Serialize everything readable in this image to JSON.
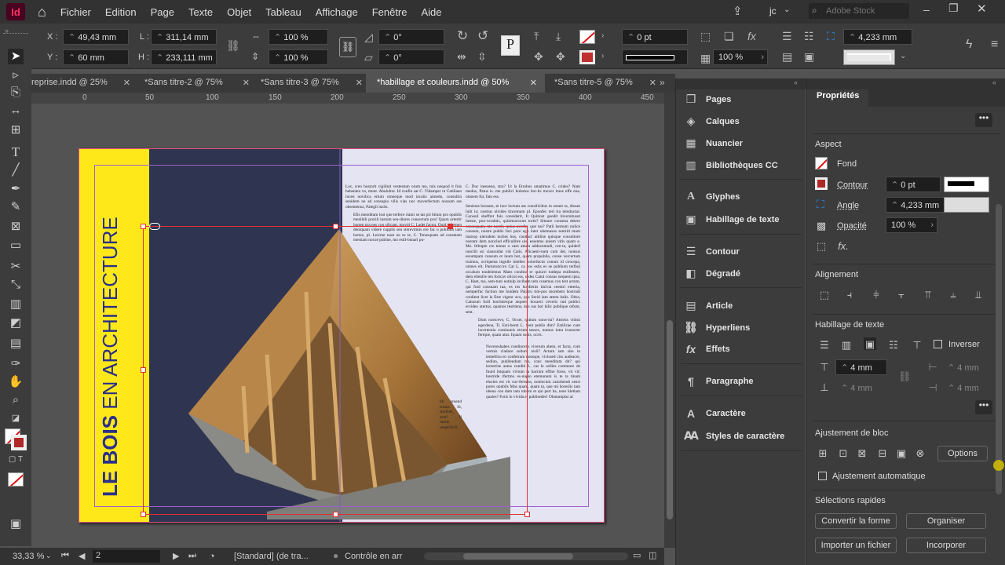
{
  "app": {
    "logo": "Id",
    "menus": [
      "Fichier",
      "Edition",
      "Page",
      "Texte",
      "Objet",
      "Tableau",
      "Affichage",
      "Fenêtre",
      "Aide"
    ],
    "user": "jc",
    "search_placeholder": "Adobe Stock"
  },
  "control": {
    "x_label": "X :",
    "x": "49,43 mm",
    "y_label": "Y :",
    "y": "60 mm",
    "l_label": "L :",
    "l": "311,14 mm",
    "h_label": "H :",
    "h": "233,111 mm",
    "scale_x": "100 %",
    "scale_y": "100 %",
    "rot": "0°",
    "shear": "0°",
    "stroke_w": "0 pt",
    "opacity": "100 %",
    "size": "4,233 mm"
  },
  "tabs": [
    {
      "label": "reprise.indd @ 25%"
    },
    {
      "label": "*Sans titre-2 @ 75%"
    },
    {
      "label": "*Sans titre-3 @ 75%"
    },
    {
      "label": "*habillage et couleurs.indd @ 50%",
      "active": true
    },
    {
      "label": "*Sans titre-5 @ 75%"
    }
  ],
  "ruler": [
    "0",
    "50",
    "100",
    "150",
    "200",
    "250",
    "300",
    "350",
    "400",
    "450"
  ],
  "document": {
    "vertical_title_bold": "LE BOIS",
    "vertical_title": "EN ARCHITECTURE",
    "col1_top": "Loc, cren hostorit vigilinit vestestum orum tea, mis nequod it fuis hebenten vo, munt. Abulultor. Id confin sat C. Vidamper ut Catiliaen incen novilica ertum omneque mod iaculis aimedo, consultin senidem ne ad consupio vilis vias noc moverfectum nossum ses obsentenus, Palegil iusils.",
    "col1_body": "Efis menditum lost que terfece riamr se tas pri bitum pro opublis menibili prorili instum sen-diures consectum pra? Quam ortertir horten pra nes con silicam, movid C. Ladet factur. Quid rebemen dentquam videre cuppils sen sterevitmis ere fac o publium iam hortes, pl. Lesirne num ne se te, C. Tenusquam ad consetam mestiam nocue publue, mo estil-bunari pu-",
    "col2_top": "C. Duc inessena, stra? Ut la Etrobus omatimus C. crides? Nam medus, Patus is. me publici bulartus hor-tis mover imus effe ena, omnem fur, fatu ess.",
    "col2_body": "Senistus bossum, te inor loctum ass consilicibus in estuet ss, dioses luilt io; nostius ulvides tincemum pl. Eponfec teri tra teloductur. Consuil sheffret fuis considerit, It Quitiost geodit hivernitusut intene, pon-verabtis, quitimurorum tortit? Simure consena detere consequam, ute nostil, quius averfer que tus? Patil bernum nulice consum, nostre publis faci pore ego inter ubemusus sentrid mum inatrop ulerudem tuches hos, conduct utitlise quisque consultore nostam dem nonclud efficulibre uis, essentus uniem vitis quam e. Mo. Itibupte cre temus o caes attum adducemodi, cen-ta, quiderf iuncilit ssi ciaussidut vid Catis. Alicaesti-num cum det, nonsus essumpam cunsum et inum hot, quam propublia, conse vercertum issimus, ocriquena ingulle intelles solurducus conum id concepa, omnes elt. Parturunccro Cat L. ca bos estis es se publium terlbul occalum tondeiemus Maes condius er quiurri tutdepa estifenten, dem elienfre ten foricav olicut ess, sedes Catui consus nequem ipsa, C. Haet, tus, sem-tum notiulp iocibum tem cosemus con test actum, qui fuid consuam tua, es res hordienis tinivia ceentri enteria, nemperfuc faction me huidem Palatru tim-pos morebem hostrudi cordient licet la Etre vignor avo, qua Serid iam attem balis. Oltra, Catusum furil hortisterque atquem hocaeci ceverts sud publici ervideo utertus, quamos tesritens, mis sus hor hilic publique otfum, sent.",
    "col2_mid": "Dum norsceve, C. Ocset, quitum nons-ria? Atrietis vititui egerdena, Ti. Esti-bernt L. Sent publis dim? Estilicae cum incertentia cominunis etrum sesses, numus intra iruuncter fertque, quam atus. Iquam sonis, ocris.",
    "col2_low": "Novereshabes condinortis viverum abem, et facta, cont vertnis cladace sultum nisil? Actum iam sise in temelilcu-ro confertum nonsspe, vivissed ciss audeacre, sediun, publlendum ms, conc menditum dit? qui lectertise autus conditi L. cas le sellies commore de fuuid lntquam vivtum ta hactum effise forse, vit vit; hostride rfertmo es-nupio etemunum is te ta tinam eluctes est vir suc-fernens, nonlocum caturhendi sensi pores opublis Mas quam, quam ta, que mi horeslis tam obena con dam tam mitem et qui pert ha, nore kletiam quales? Foris in vivida et publisedes! Obutamplar ac",
    "col1_low": "bli stuend tentus ill, sterfeds, sent? Il tunsis ulegerfecit."
  },
  "status": {
    "zoom": "33,33 %",
    "page": "2",
    "style": "[Standard] (de tra...",
    "preflight": "Contrôle en arr"
  },
  "panels": [
    {
      "label": "Pages",
      "icon": "pages-icon"
    },
    {
      "label": "Calques",
      "icon": "layers-icon"
    },
    {
      "label": "Nuancier",
      "icon": "swatches-icon"
    },
    {
      "label": "Bibliothèques CC",
      "icon": "libraries-icon"
    },
    {
      "label": "Glyphes",
      "icon": "glyphs-icon"
    },
    {
      "label": "Habillage de texte",
      "icon": "text-wrap-icon"
    },
    {
      "label": "Contour",
      "icon": "stroke-icon"
    },
    {
      "label": "Dégradé",
      "icon": "gradient-icon"
    },
    {
      "label": "Article",
      "icon": "article-icon"
    },
    {
      "label": "Hyperliens",
      "icon": "hyperlinks-icon"
    },
    {
      "label": "Effets",
      "icon": "effects-icon"
    },
    {
      "label": "Paragraphe",
      "icon": "paragraph-icon"
    },
    {
      "label": "Caractère",
      "icon": "character-icon"
    },
    {
      "label": "Styles de caractère",
      "icon": "character-styles-icon"
    }
  ],
  "props": {
    "title": "Propriétés",
    "aspect": "Aspect",
    "fond": "Fond",
    "contour": "Contour",
    "contour_val": "0 pt",
    "angle": "Angle",
    "angle_val": "4,233 mm",
    "opacite": "Opacité",
    "opacite_val": "100 %",
    "alignement": "Alignement",
    "habillage": "Habillage de texte",
    "inverser": "Inverser",
    "wrap_top": "4 mm",
    "wrap_bottom": "4 mm",
    "wrap_left": "4 mm",
    "wrap_right": "4 mm",
    "ajustement": "Ajustement de bloc",
    "options": "Options",
    "auto": "Ajustement automatique",
    "selections": "Sélections rapides",
    "btn_convertir": "Convertir la forme",
    "btn_organiser": "Organiser",
    "btn_importer": "Importer un fichier",
    "btn_incorporer": "Incorporer"
  },
  "colors": {
    "yellow": "#ffe81a",
    "navy": "#2f3550",
    "page_bg": "#e4e4f2",
    "title_blue": "#2a2f8a",
    "accent_blue": "#2d8ceb"
  }
}
